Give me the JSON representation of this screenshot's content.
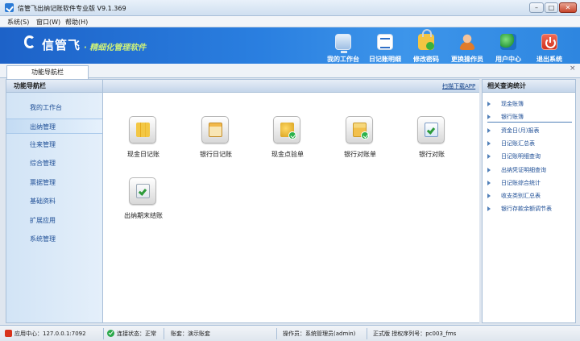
{
  "window": {
    "title": "信管飞出纳记账软件专业版 V9.1.369"
  },
  "menu": {
    "items": [
      {
        "label": "系统(S)"
      },
      {
        "label": "窗口(W)"
      },
      {
        "label": "帮助(H)"
      }
    ]
  },
  "banner": {
    "logo": "信管飞",
    "subtitle": "· 精细化管理软件",
    "tools": [
      {
        "label": "我的工作台",
        "icon": "monitor-icon"
      },
      {
        "label": "日记账明细",
        "icon": "ledger-icon"
      },
      {
        "label": "修改密码",
        "icon": "lock-icon"
      },
      {
        "label": "更换操作员",
        "icon": "user-icon"
      },
      {
        "label": "用户中心",
        "icon": "globe-icon"
      },
      {
        "label": "退出系统",
        "icon": "power-icon"
      }
    ]
  },
  "tabs": {
    "active": "功能导航栏",
    "close": "×"
  },
  "left_nav": {
    "title": "功能导航栏",
    "items": [
      {
        "label": "我的工作台"
      },
      {
        "label": "出纳管理"
      },
      {
        "label": "往来管理"
      },
      {
        "label": "综合管理"
      },
      {
        "label": "票据管理"
      },
      {
        "label": "基础资料"
      },
      {
        "label": "扩展应用"
      },
      {
        "label": "系统管理"
      }
    ]
  },
  "main": {
    "scan_link": "扫描下载APP",
    "functions": [
      {
        "label": "现金日记账",
        "icon": "cash-journal-icon"
      },
      {
        "label": "银行日记账",
        "icon": "bank-journal-icon"
      },
      {
        "label": "现金点验单",
        "icon": "coins-check-icon"
      },
      {
        "label": "银行对账单",
        "icon": "bank-statement-icon"
      },
      {
        "label": "银行对账",
        "icon": "reconcile-icon"
      },
      {
        "label": "出纳期末结账",
        "icon": "period-close-icon"
      }
    ]
  },
  "right_panel": {
    "title": "相关查询统计",
    "items": [
      {
        "label": "现金账簿"
      },
      {
        "label": "银行账簿"
      },
      {
        "label": "资金日(月)报表"
      },
      {
        "label": "日记账汇总表"
      },
      {
        "label": "日记账明细查询"
      },
      {
        "label": "出纳凭证明细查询"
      },
      {
        "label": "日记账综合统计"
      },
      {
        "label": "收支类别汇总表"
      },
      {
        "label": "银行存款余额调节表"
      }
    ]
  },
  "statusbar": {
    "app_center": "应用中心：127.0.0.1:7092",
    "connection": "连接状态：正常",
    "account": "账套：演示账套",
    "operator": "操作员：系统管理员(admin)",
    "license": "正式版 授权序列号：pc003_fms"
  },
  "colors": {
    "banner": "#2a7fe0",
    "accent_link": "#1f4f96",
    "subtitle": "#cdf07a"
  }
}
